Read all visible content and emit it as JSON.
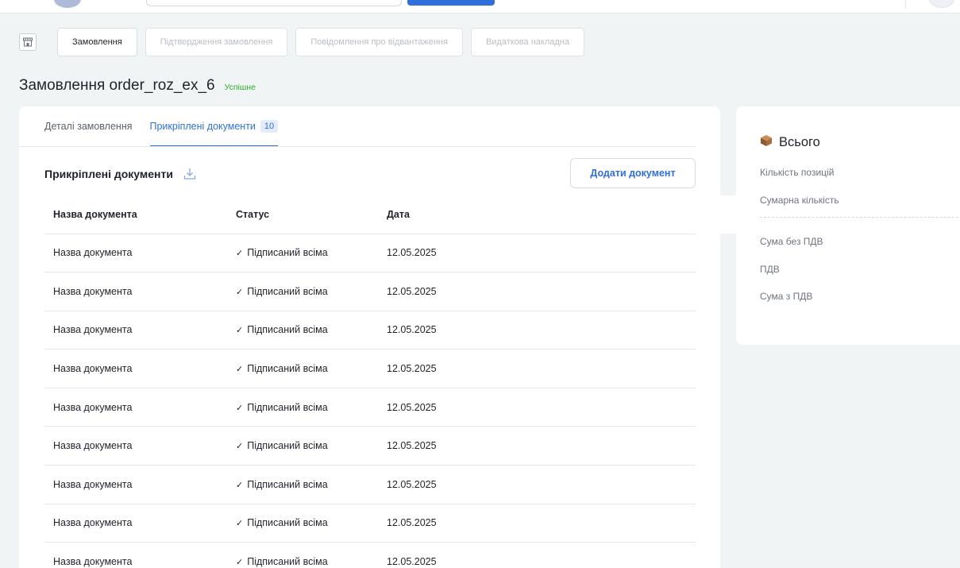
{
  "tabs_steps": [
    {
      "label": "Замовлення",
      "active": true
    },
    {
      "label": "Підтвердження замовлення",
      "active": false
    },
    {
      "label": "Повідомлення про відвантаження",
      "active": false
    },
    {
      "label": "Видаткова накладна",
      "active": false
    }
  ],
  "page": {
    "title": "Замовлення order_roz_ex_6",
    "status": "Успішне"
  },
  "detail_tabs": {
    "details_label": "Деталі замовлення",
    "attached_label": "Прикріплені документи",
    "attached_count": "10"
  },
  "documents": {
    "section_title": "Прикріплені документи",
    "add_button": "Додати документ",
    "columns": [
      "Назва документа",
      "Статус",
      "Дата"
    ],
    "rows": [
      {
        "name": "Назва документа",
        "status": "Підписаний всіма",
        "date": "12.05.2025"
      },
      {
        "name": "Назва документа",
        "status": "Підписаний всіма",
        "date": "12.05.2025"
      },
      {
        "name": "Назва документа",
        "status": "Підписаний всіма",
        "date": "12.05.2025"
      },
      {
        "name": "Назва документа",
        "status": "Підписаний всіма",
        "date": "12.05.2025"
      },
      {
        "name": "Назва документа",
        "status": "Підписаний всіма",
        "date": "12.05.2025"
      },
      {
        "name": "Назва документа",
        "status": "Підписаний всіма",
        "date": "12.05.2025"
      },
      {
        "name": "Назва документа",
        "status": "Підписаний всіма",
        "date": "12.05.2025"
      },
      {
        "name": "Назва документа",
        "status": "Підписаний всіма",
        "date": "12.05.2025"
      },
      {
        "name": "Назва документа",
        "status": "Підписаний всіма",
        "date": "12.05.2025"
      }
    ]
  },
  "summary": {
    "icon": "package-icon",
    "title": "Всього",
    "rows": [
      "Кількість позицій",
      "Сумарна кількість",
      "Сума без ПДВ",
      "ПДВ",
      "Сума з ПДВ"
    ]
  },
  "colors": {
    "accent": "#2f6fdb",
    "success": "#2cae29",
    "background": "#f1f4f4"
  }
}
